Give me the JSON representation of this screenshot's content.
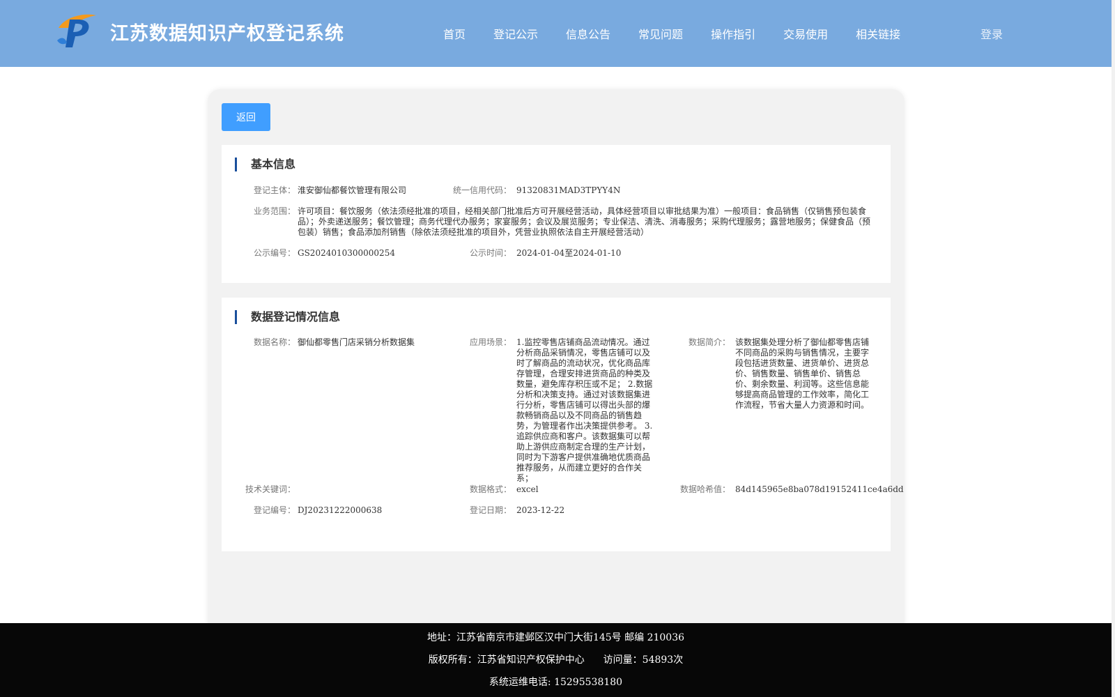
{
  "header": {
    "title": "江苏数据知识产权登记系统",
    "nav": [
      "首页",
      "登记公示",
      "信息公告",
      "常见问题",
      "操作指引",
      "交易使用",
      "相关链接"
    ],
    "login": "登录"
  },
  "actions": {
    "back": "返回"
  },
  "basic": {
    "title": "基本信息",
    "subject_label": "登记主体：",
    "subject": "淮安御仙都餐饮管理有限公司",
    "credit_label": "统一信用代码：",
    "credit": "91320831MAD3TPYY4N",
    "scope_label": "业务范围：",
    "scope": "许可项目：餐饮服务（依法须经批准的项目，经相关部门批准后方可开展经营活动，具体经营项目以审批结果为准）一般项目：食品销售（仅销售预包装食品）；外卖递送服务；餐饮管理；商务代理代办服务；家宴服务；会议及展览服务；专业保洁、清洗、消毒服务；采购代理服务；露营地服务；保健食品（预包装）销售；食品添加剂销售（除依法须经批准的项目外，凭营业执照依法自主开展经营活动）",
    "notice_no_label": "公示编号：",
    "notice_no": "GS2024010300000254",
    "notice_time_label": "公示时间：",
    "notice_time": "2024-01-04至2024-01-10"
  },
  "data_reg": {
    "title": "数据登记情况信息",
    "name_label": "数据名称：",
    "name": "御仙都零售门店采销分析数据集",
    "scene_label": "应用场景：",
    "scene": "1.监控零售店铺商品流动情况。通过分析商品采销情况，零售店铺可以及时了解商品的流动状况，优化商品库存管理，合理安排进货商品的种类及数量，避免库存积压或不足； 2.数据分析和决策支持。通过对该数据集进行分析，零售店铺可以得出头部的爆款畅销商品以及不同商品的销售趋势，为管理者作出决策提供参考。 3.追踪供应商和客户。该数据集可以帮助上游供应商制定合理的生产计划，同时为下游客户提供准确地优质商品推荐服务，从而建立更好的合作关系；",
    "intro_label": "数据简介：",
    "intro": "该数据集处理分析了御仙都零售店铺不同商品的采购与销售情况，主要字段包括进货数量、进货单价、进货总价、销售数量、销售单价、销售总价、剩余数量、利润等。这些信息能够提高商品管理的工作效率，简化工作流程，节省大量人力资源和时间。",
    "keywords_label": "技术关键词：",
    "keywords": "",
    "format_label": "数据格式：",
    "format": "excel",
    "hash_label": "数据哈希值：",
    "hash": "84d145965e8ba078d19152411ce4a6dd",
    "reg_no_label": "登记编号：",
    "reg_no": "DJ20231222000638",
    "reg_date_label": "登记日期：",
    "reg_date": "2023-12-22"
  },
  "footer": {
    "address": "地址：江苏省南京市建邺区汉中门大街145号 邮编 210036",
    "copyright": "版权所有：江苏省知识产权保护中心",
    "visits": "访问量：54893次",
    "phone": "系统运维电话: 15295538180"
  }
}
